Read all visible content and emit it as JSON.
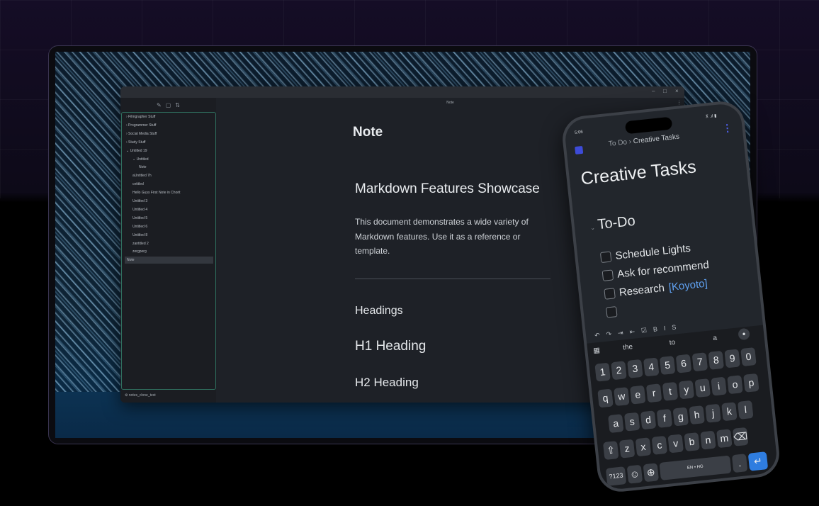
{
  "desktop": {
    "window_controls": [
      "–",
      "□",
      "×"
    ],
    "sidebar_toolbar_icons": [
      "edit-icon",
      "folder-icon",
      "sort-icon"
    ],
    "sidebar_toolbar_glyphs": [
      "✎",
      "▢",
      "⇅"
    ],
    "tree": [
      {
        "label": "› Filmgrapher Stuff",
        "indent": 0
      },
      {
        "label": "› Programmer Stuff",
        "indent": 0
      },
      {
        "label": "› Social Media Stuff",
        "indent": 0
      },
      {
        "label": "› Study Stuff",
        "indent": 0
      },
      {
        "label": "⌄ Untitled 19",
        "indent": 0
      },
      {
        "label": "⌄ Untitled",
        "indent": 1
      },
      {
        "label": "Note",
        "indent": 2
      },
      {
        "label": "aUntitled 7h",
        "indent": 1
      },
      {
        "label": "cntitled",
        "indent": 1
      },
      {
        "label": "Hello Guys First Note in Chorit",
        "indent": 1
      },
      {
        "label": "Untitled 3",
        "indent": 1
      },
      {
        "label": "Untitled 4",
        "indent": 1
      },
      {
        "label": "Untitled 5",
        "indent": 1
      },
      {
        "label": "Untitled 6",
        "indent": 1
      },
      {
        "label": "Untitled 8",
        "indent": 1
      },
      {
        "label": "zantitled 2",
        "indent": 1
      },
      {
        "label": "zergperg",
        "indent": 1
      },
      {
        "label": "Note",
        "indent": 0,
        "selected": true
      }
    ],
    "vault_name": "notes_clone_test",
    "editor_tab_title": "Note",
    "note_title": "Note",
    "doc_heading": "Markdown Features Showcase",
    "doc_intro": "This document demonstrates a wide variety of Markdown features. Use it as a reference or template.",
    "section_headings": "Headings",
    "h1_example": "H1 Heading",
    "h2_example": "H2 Heading"
  },
  "phone": {
    "time": "5:06",
    "status_icons": "⊼ .ıl ▮",
    "breadcrumb_parent": "To Do",
    "breadcrumb_sep": "›",
    "breadcrumb_current": "Creative Tasks",
    "menu_glyph": "⋮",
    "title": "Creative Tasks",
    "section": "To-Do",
    "tasks": [
      {
        "text": "Schedule Lights",
        "link": ""
      },
      {
        "text": "Ask for recommend",
        "link": ""
      },
      {
        "text": "Research ",
        "link": "[Koyoto]"
      },
      {
        "text": "",
        "link": ""
      }
    ],
    "format_toolbar": [
      "↶",
      "↷",
      "⇥",
      "⇤",
      "☑",
      "B",
      "I",
      "S"
    ],
    "suggestions": [
      "the",
      "to",
      "a"
    ],
    "keyboard_rows": [
      [
        "1",
        "2",
        "3",
        "4",
        "5",
        "6",
        "7",
        "8",
        "9",
        "0"
      ],
      [
        "q",
        "w",
        "e",
        "r",
        "t",
        "y",
        "u",
        "i",
        "o",
        "p"
      ],
      [
        "a",
        "s",
        "d",
        "f",
        "g",
        "h",
        "j",
        "k",
        "l"
      ],
      [
        "⇧",
        "z",
        "x",
        "c",
        "v",
        "b",
        "n",
        "m",
        "⌫"
      ]
    ],
    "bottom_keys": {
      "symbols": "?123",
      "emoji": "☺",
      "globe": "⊕",
      "space": "EN • HG",
      "period": ".",
      "enter": "↵"
    }
  }
}
